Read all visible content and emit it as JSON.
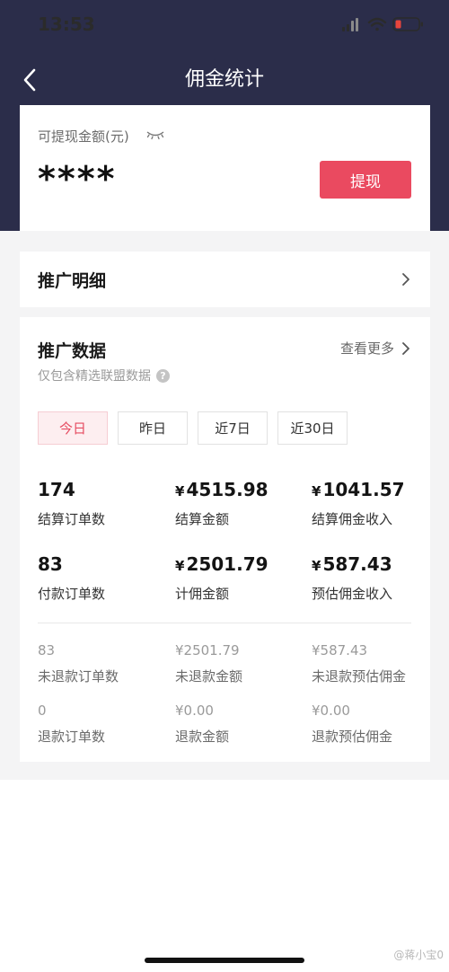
{
  "status_bar": {
    "time": "13:53"
  },
  "nav": {
    "title": "佣金统计"
  },
  "balance": {
    "label": "可提现金额(元)",
    "amount": "****",
    "withdraw_label": "提现"
  },
  "detail": {
    "title": "推广明细"
  },
  "data": {
    "title": "推广数据",
    "view_more": "查看更多",
    "subtitle": "仅包含精选联盟数据",
    "help": "?",
    "tabs": [
      {
        "label": "今日",
        "active": true
      },
      {
        "label": "昨日",
        "active": false
      },
      {
        "label": "近7日",
        "active": false
      },
      {
        "label": "近30日",
        "active": false
      }
    ],
    "stats": [
      {
        "value": "174",
        "label": "结算订单数"
      },
      {
        "value": "4515.98",
        "currency": "¥",
        "label": "结算金额"
      },
      {
        "value": "1041.57",
        "currency": "¥",
        "label": "结算佣金收入"
      },
      {
        "value": "83",
        "label": "付款订单数"
      },
      {
        "value": "2501.79",
        "currency": "¥",
        "label": "计佣金额"
      },
      {
        "value": "587.43",
        "currency": "¥",
        "label": "预估佣金收入"
      }
    ],
    "refund_stats": [
      {
        "value": "83",
        "label": "未退款订单数"
      },
      {
        "value": "¥2501.79",
        "label": "未退款金额"
      },
      {
        "value": "¥587.43",
        "label": "未退款预估佣金"
      },
      {
        "value": "0",
        "label": "退款订单数"
      },
      {
        "value": "¥0.00",
        "label": "退款金额"
      },
      {
        "value": "¥0.00",
        "label": "退款预估佣金"
      }
    ]
  },
  "watermark": "@蒋小宝0",
  "colors": {
    "header": "#2b2d4a",
    "accent": "#ea4a60",
    "tab_active_bg": "#fdeef0"
  }
}
